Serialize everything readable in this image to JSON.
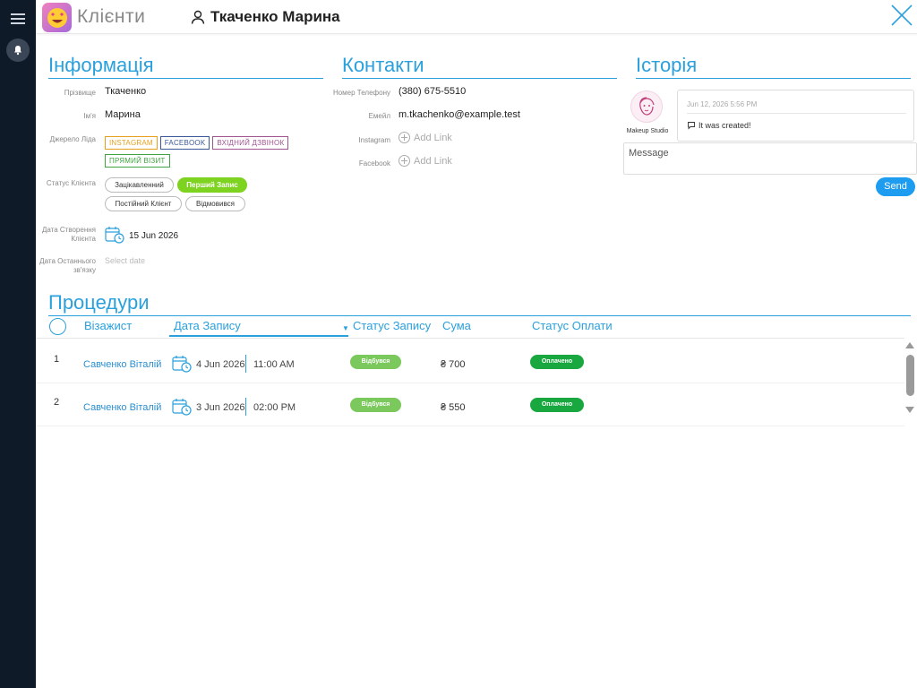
{
  "header": {
    "app_title": "Клієнти",
    "client_name": "Ткаченко Марина"
  },
  "info": {
    "title": "Інформація",
    "surname_label": "Прізвище",
    "surname": "Ткаченко",
    "name_label": "Ім'я",
    "name": "Марина",
    "source_label": "Джерело Ліда",
    "sources": [
      {
        "label": "INSTAGRAM",
        "color": "#e6a01e"
      },
      {
        "label": "FACEBOOK",
        "color": "#3b5998"
      },
      {
        "label": "ВХІДНИЙ ДЗВІНОК",
        "color": "#a05590"
      },
      {
        "label": "ПРЯМИЙ ВІЗИТ",
        "color": "#3fa33f"
      }
    ],
    "status_label": "Статус Клієнта",
    "statuses": [
      "Зацікавленний",
      "Перший Запис",
      "Постійний Клієнт",
      "Відмовився"
    ],
    "active_status": "Перший Запис",
    "created_label": "Дата Створення Клієнта",
    "created_date": "15 Jun 2026",
    "last_contact_label": "Дата Останнього зв'язку",
    "last_contact_placeholder": "Select date"
  },
  "contacts": {
    "title": "Контакти",
    "phone_label": "Номер Телефону",
    "phone": "(380) 675-5510",
    "email_label": "Емейл",
    "email": "m.tkachenko@example.test",
    "instagram_label": "Instagram",
    "facebook_label": "Facebook",
    "add_link": "Add Link"
  },
  "history": {
    "title": "Історія",
    "avatar_caption": "Makeup Studio",
    "entry_date": "Jun 12, 2026 5:56 PM",
    "entry_text": "It was created!",
    "message_placeholder": "Message",
    "send_label": "Send"
  },
  "procedures": {
    "title": "Процедури",
    "columns": {
      "artist": "Візажист",
      "date": "Дата Запису",
      "status": "Статус Запису",
      "sum": "Сума",
      "payment": "Статус Оплати"
    },
    "rows": [
      {
        "num": "1",
        "artist": "Савченко Віталій",
        "date": "4 Jun 2026",
        "time": "11:00 AM",
        "status": "Відбувся",
        "sum": "₴ 700",
        "payment": "Оплачено"
      },
      {
        "num": "2",
        "artist": "Савченко Віталій",
        "date": "3 Jun 2026",
        "time": "02:00 PM",
        "status": "Відбувся",
        "sum": "₴ 550",
        "payment": "Оплачено"
      }
    ]
  },
  "colors": {
    "accent": "#2aa0dc",
    "active_status": "#7ed321",
    "paid": "#18a83f",
    "rail": "#0f1a29"
  }
}
